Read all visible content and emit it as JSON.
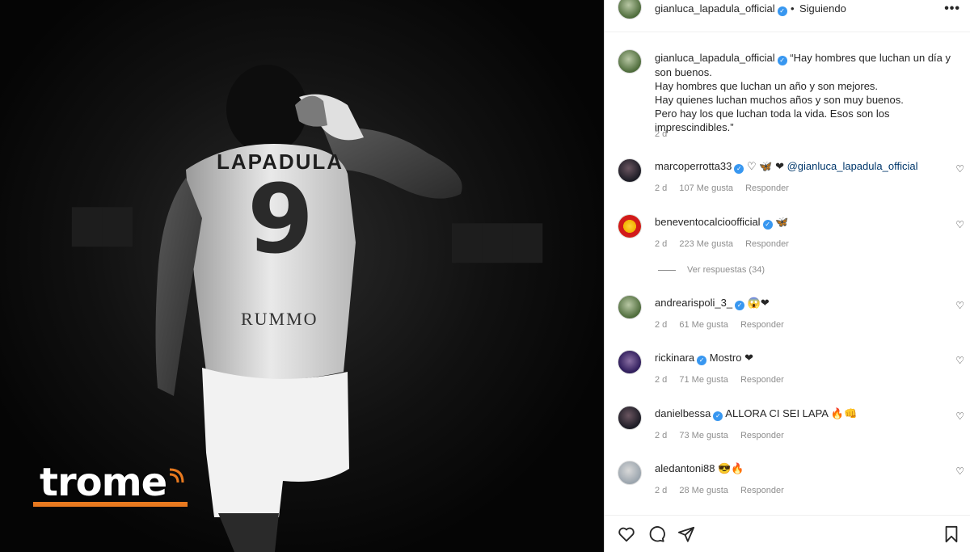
{
  "photo": {
    "jersey_name": "LAPADULA",
    "jersey_number": "9",
    "jersey_sponsor": "RUMMO",
    "logo_text": "trome",
    "accent_color": "#e8791f"
  },
  "header": {
    "username": "gianluca_lapadula_official",
    "separator": "•",
    "follow_status": "Siguiendo",
    "more_icon": "more-horizontal-icon"
  },
  "caption": {
    "username": "gianluca_lapadula_official",
    "text": "“Hay hombres que luchan un día y son buenos.\nHay hombres que luchan un año y son mejores.\nHay quienes luchan muchos años y son muy buenos.\nPero hay los que luchan toda la vida. Esos son los imprescindibles.”",
    "time": "2 d"
  },
  "comments": [
    {
      "username": "marcoperrotta33",
      "text": "♡ 🦋 ❤",
      "mention": "@gianluca_lapadula_official",
      "time": "2 d",
      "likes": "107 Me gusta",
      "reply": "Responder"
    },
    {
      "username": "beneventocalcioofficial",
      "text": "🦋",
      "time": "2 d",
      "likes": "223 Me gusta",
      "reply": "Responder"
    },
    {
      "username": "andrearispoli_3_",
      "text": "😱❤",
      "time": "2 d",
      "likes": "61 Me gusta",
      "reply": "Responder"
    },
    {
      "username": "rickinara",
      "text": "Mostro ❤",
      "time": "2 d",
      "likes": "71 Me gusta",
      "reply": "Responder"
    },
    {
      "username": "danielbessa",
      "text": "ALLORA CI SEI LAPA 🔥👊",
      "time": "2 d",
      "likes": "73 Me gusta",
      "reply": "Responder"
    },
    {
      "username": "aledantoni88",
      "text": "😎🔥",
      "time": "2 d",
      "likes": "28 Me gusta",
      "reply": "Responder"
    }
  ],
  "replies_label": "Ver respuestas (34)",
  "actions": {
    "like_icon": "heart-icon",
    "comment_icon": "comment-icon",
    "share_icon": "share-icon",
    "save_icon": "bookmark-icon"
  }
}
